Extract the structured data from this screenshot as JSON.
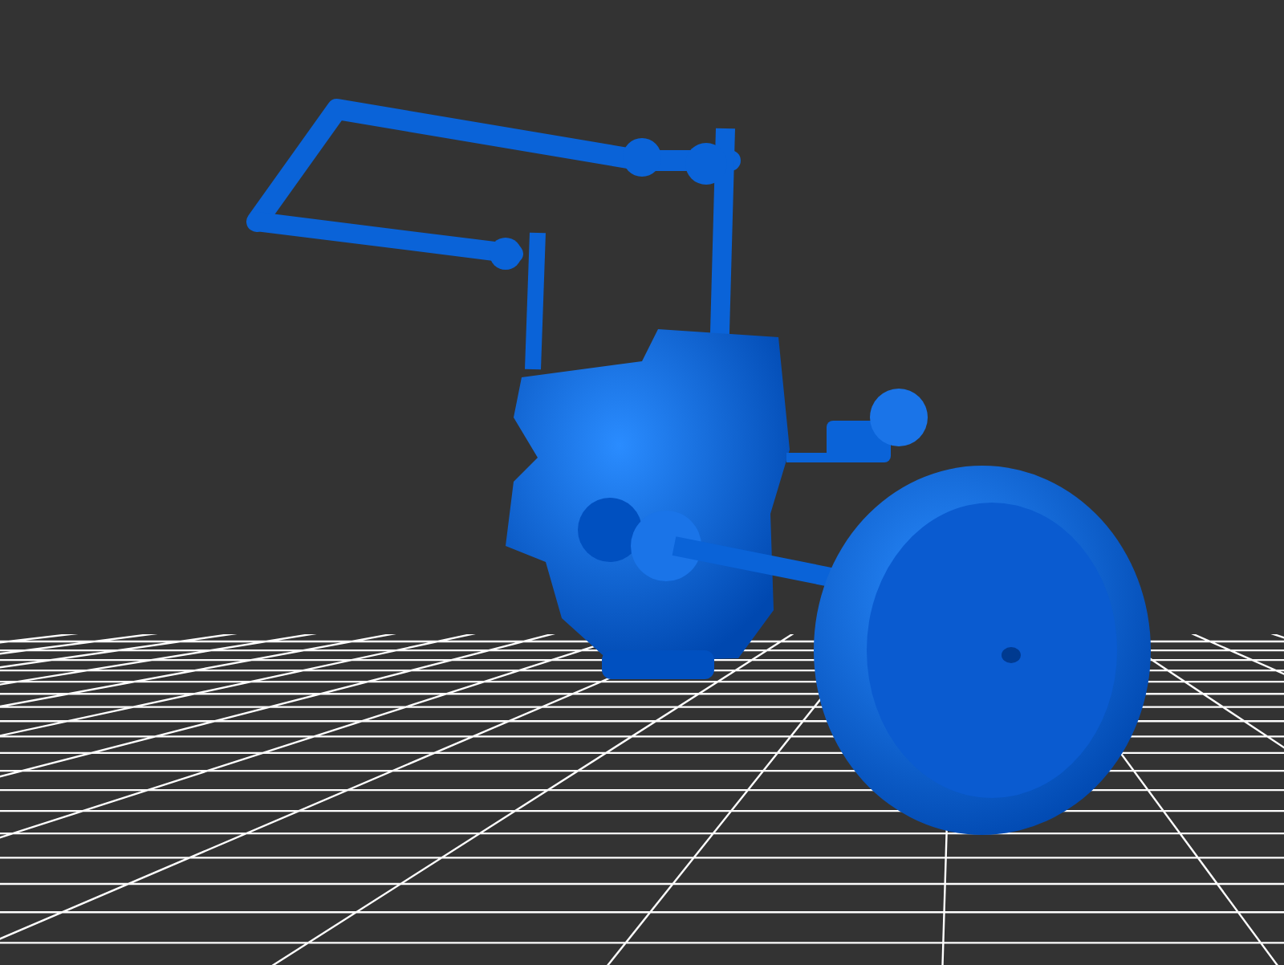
{
  "viewport": {
    "floor_grid": true
  }
}
